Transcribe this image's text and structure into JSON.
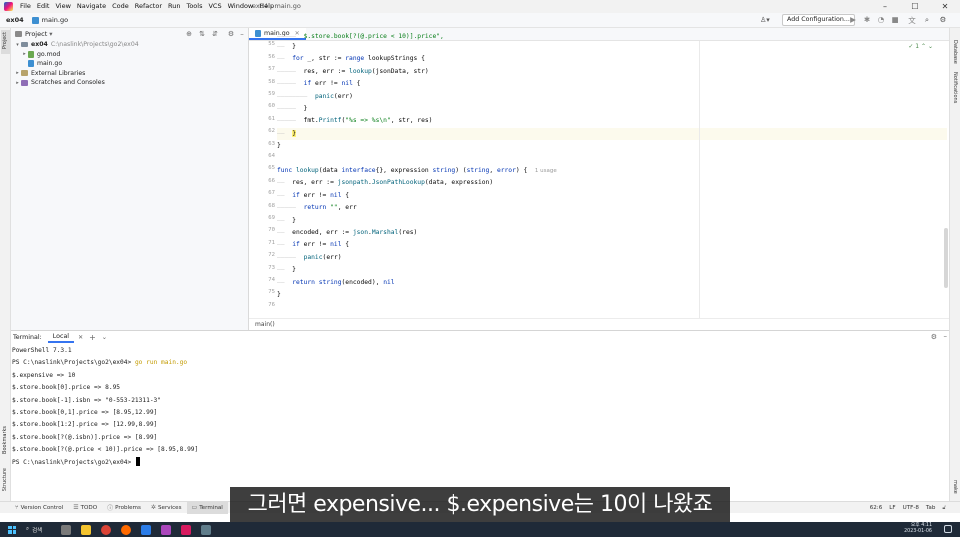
{
  "menubar": {
    "items": [
      "File",
      "Edit",
      "View",
      "Navigate",
      "Code",
      "Refactor",
      "Run",
      "Tools",
      "VCS",
      "Window",
      "Help"
    ],
    "window_title": "ex04 - main.go"
  },
  "navbar": {
    "project": "ex04",
    "file": "main.go",
    "run_config": "Add Configuration..."
  },
  "left_strip": {
    "top": "Project",
    "bottom1": "Bookmarks",
    "bottom2": "Structure"
  },
  "right_strip": {
    "top1": "Database",
    "top2": "Notifications",
    "bottom": "make"
  },
  "project_panel": {
    "title": "Project",
    "root": {
      "name": "ex04",
      "path": "C:\\naslink\\Projects\\go2\\ex04"
    },
    "files": [
      "go.mod",
      "main.go"
    ],
    "external": "External Libraries",
    "scratches": "Scratches and Consoles"
  },
  "editor": {
    "tab": "main.go",
    "breadcrumb": "main()",
    "inspection": "1",
    "line_numbers": [
      "55",
      "56",
      "57",
      "58",
      "59",
      "60",
      "61",
      "62",
      "63",
      "64",
      "65",
      "66",
      "67",
      "68",
      "69",
      "70",
      "71",
      "72",
      "73",
      "74",
      "75",
      "76"
    ],
    "top_partial": "$.store.book[?(@.price < 10)].price\","
  },
  "terminal": {
    "title": "Terminal:",
    "tab": "Local",
    "lines": [
      "PowerShell 7.3.1",
      "PS C:\\naslink\\Projects\\go2\\ex04> ",
      "$.expensive => 10",
      "$.store.book[0].price => 8.95",
      "$.store.book[-1].isbn => \"0-553-21311-3\"",
      "$.store.book[0,1].price => [8.95,12.99]",
      "$.store.book[1:2].price => [12.99,8.99]",
      "$.store.book[?(@.isbn)].price => [8.99]",
      "$.store.book[?(@.price < 10)].price => [8.95,8.99]",
      "PS C:\\naslink\\Projects\\go2\\ex04> "
    ],
    "command": "go run main.go"
  },
  "bottom_tools": [
    "Version Control",
    "TODO",
    "Problems",
    "Services",
    "Terminal"
  ],
  "status": {
    "position": "62:6",
    "line_sep": "LF",
    "encoding": "UTF-8",
    "indent": "Tab"
  },
  "subtitle": "그러면 expensive... $.expensive는 10이 나왔죠",
  "taskbar": {
    "search": "검색",
    "time": "오후 4:11",
    "date": "2023-01-06"
  },
  "colors": {
    "accent": "#3574f0",
    "keyword": "#0033b3",
    "function": "#00627a",
    "string": "#067d17"
  }
}
